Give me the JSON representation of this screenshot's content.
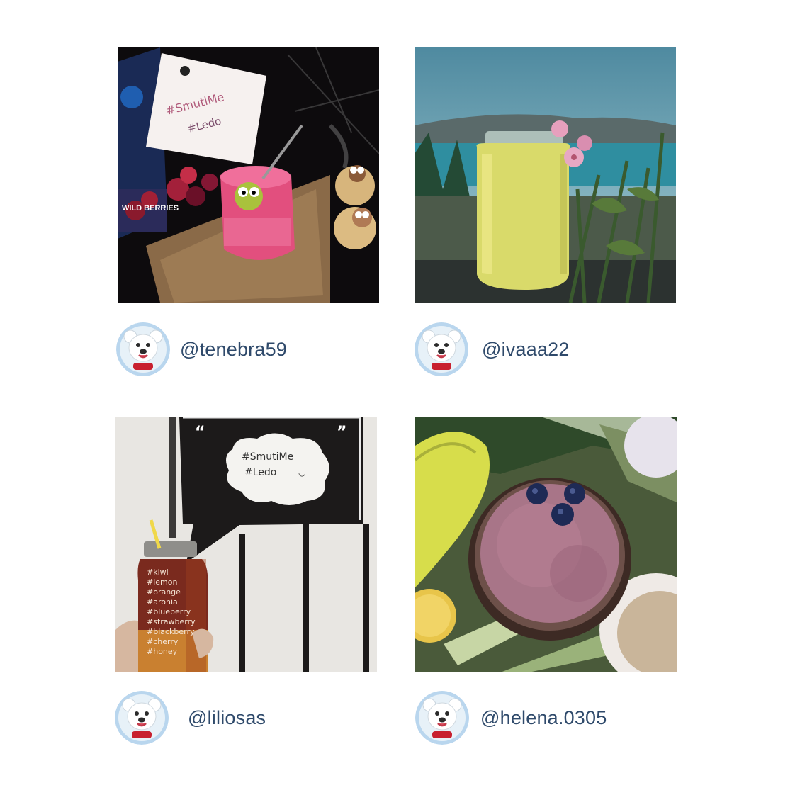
{
  "posts": [
    {
      "handle": "@tenebra59",
      "photo_subject": "pink berry smoothie with googly-eye kiwi, note reading #SmutiMe #Ledo",
      "note_lines": [
        "#SmutiMe",
        "#Ledo"
      ],
      "bag_text": "WILD BERRIES",
      "avatar_icon": "polar-bear-mascot-icon"
    },
    {
      "handle": "@ivaaa22",
      "photo_subject": "yellow smoothie in mason jar with pink flowers, sea view",
      "avatar_icon": "polar-bear-mascot-icon"
    },
    {
      "handle": "@liliosas",
      "photo_subject": "layered fruit smoothie jar with handwritten ingredient list",
      "bubble_lines": [
        "#SmutiMe",
        "#Ledo"
      ],
      "jar_lines": [
        "#kiwi",
        "#lemon",
        "#orange",
        "#aronia",
        "#blueberry",
        "#strawberry",
        "#blackberry",
        "#cherry",
        "#honey"
      ],
      "avatar_icon": "polar-bear-mascot-icon"
    },
    {
      "handle": "@helena.0305",
      "photo_subject": "purple blueberry smoothie top view with banana",
      "avatar_icon": "polar-bear-mascot-icon"
    }
  ],
  "colors": {
    "handle_text": "#2f4a6b",
    "avatar_ring": "#b9d6ee",
    "background": "#ffffff"
  }
}
